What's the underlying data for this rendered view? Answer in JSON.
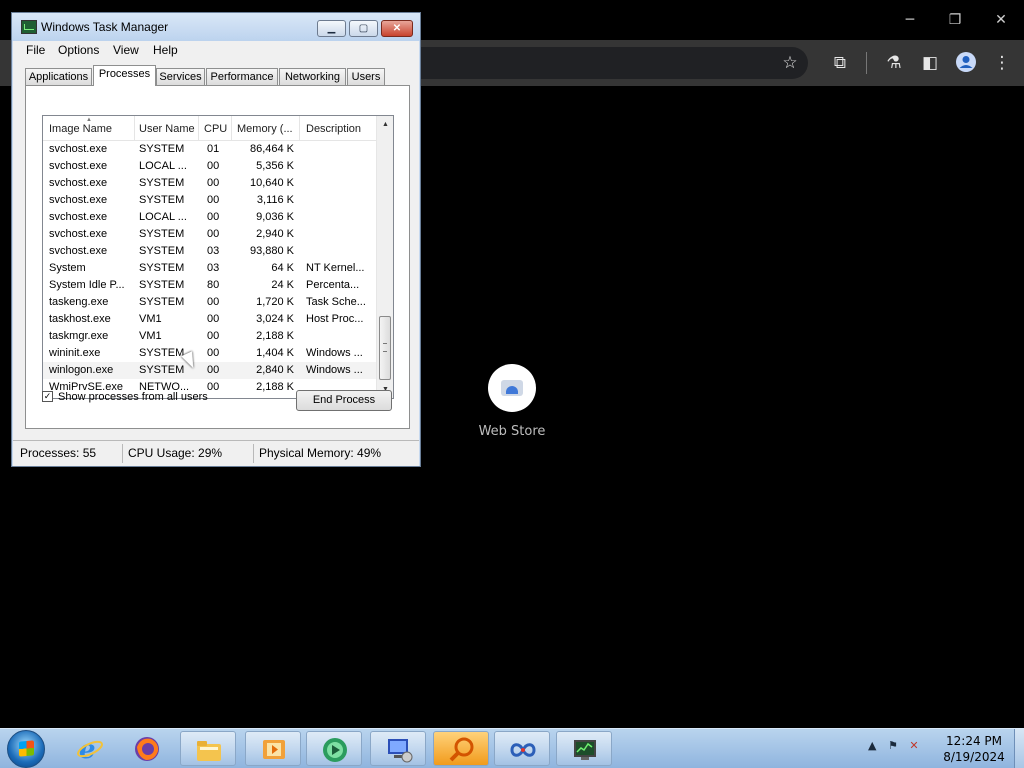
{
  "chrome": {
    "window_controls": {
      "minimize": "─",
      "restore": "❐",
      "close": "✕"
    },
    "toolbar_icons": [
      "star-icon",
      "extensions-icon",
      "labs-icon",
      "sidepanel-icon",
      "profile-icon",
      "menu-icon"
    ],
    "webstore_label": "Web Store"
  },
  "taskmgr": {
    "title": "Windows Task Manager",
    "buttons": {
      "minimize": "▁",
      "maximize": "▢",
      "close": "✕"
    },
    "menu": [
      "File",
      "Options",
      "View",
      "Help"
    ],
    "tabs": [
      "Applications",
      "Processes",
      "Services",
      "Performance",
      "Networking",
      "Users"
    ],
    "active_tab": "Processes",
    "columns": [
      "Image Name",
      "User Name",
      "CPU",
      "Memory (...",
      "Description"
    ],
    "rows": [
      {
        "image": "svchost.exe",
        "user": "SYSTEM",
        "cpu": "01",
        "mem": "86,464 K",
        "desc": ""
      },
      {
        "image": "svchost.exe",
        "user": "LOCAL ...",
        "cpu": "00",
        "mem": "5,356 K",
        "desc": ""
      },
      {
        "image": "svchost.exe",
        "user": "SYSTEM",
        "cpu": "00",
        "mem": "10,640 K",
        "desc": ""
      },
      {
        "image": "svchost.exe",
        "user": "SYSTEM",
        "cpu": "00",
        "mem": "3,116 K",
        "desc": ""
      },
      {
        "image": "svchost.exe",
        "user": "LOCAL ...",
        "cpu": "00",
        "mem": "9,036 K",
        "desc": ""
      },
      {
        "image": "svchost.exe",
        "user": "SYSTEM",
        "cpu": "00",
        "mem": "2,940 K",
        "desc": ""
      },
      {
        "image": "svchost.exe",
        "user": "SYSTEM",
        "cpu": "03",
        "mem": "93,880 K",
        "desc": ""
      },
      {
        "image": "System",
        "user": "SYSTEM",
        "cpu": "03",
        "mem": "64 K",
        "desc": "NT Kernel..."
      },
      {
        "image": "System Idle P...",
        "user": "SYSTEM",
        "cpu": "80",
        "mem": "24 K",
        "desc": "Percenta..."
      },
      {
        "image": "taskeng.exe",
        "user": "SYSTEM",
        "cpu": "00",
        "mem": "1,720 K",
        "desc": "Task Sche..."
      },
      {
        "image": "taskhost.exe",
        "user": "VM1",
        "cpu": "00",
        "mem": "3,024 K",
        "desc": "Host Proc..."
      },
      {
        "image": "taskmgr.exe",
        "user": "VM1",
        "cpu": "00",
        "mem": "2,188 K",
        "desc": ""
      },
      {
        "image": "wininit.exe",
        "user": "SYSTEM",
        "cpu": "00",
        "mem": "1,404 K",
        "desc": "Windows ..."
      },
      {
        "image": "winlogon.exe",
        "user": "SYSTEM",
        "cpu": "00",
        "mem": "2,840 K",
        "desc": "Windows ..."
      },
      {
        "image": "WmiPrvSE.exe",
        "user": "NETWO...",
        "cpu": "00",
        "mem": "2,188 K",
        "desc": ""
      }
    ],
    "show_all_label": "Show processes from all users",
    "show_all_checked": true,
    "end_process_label": "End Process",
    "status": {
      "processes": "Processes: 55",
      "cpu": "CPU Usage: 29%",
      "memory": "Physical Memory: 49%"
    }
  },
  "taskbar": {
    "pinned": [
      "internet-explorer-icon",
      "firefox-icon",
      "file-explorer-icon",
      "media-player-icon",
      "media-center-icon",
      "remote-desktop-icon",
      "search-magnifier-icon",
      "infinity-app-icon",
      "task-manager-icon"
    ],
    "clock_time": "12:24 PM",
    "clock_date": "8/19/2024"
  }
}
